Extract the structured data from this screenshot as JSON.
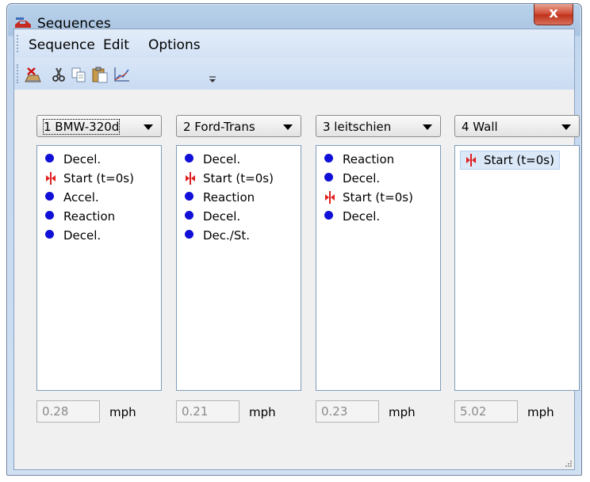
{
  "window": {
    "title": "Sequences",
    "close_label": "x"
  },
  "menu": [
    "Sequence",
    "Edit",
    "Options"
  ],
  "toolbar_icons": [
    "delete-icon",
    "cut-icon",
    "copy-icon",
    "paste-icon",
    "chart-icon",
    "toolbar-overflow-icon"
  ],
  "colors": {
    "dot": "#1010d8",
    "start_marker": "#e02020",
    "title_bar": "#b9d1ea",
    "close_button": "#c0331c"
  },
  "panels": [
    {
      "selector": "1 BMW-320d",
      "items": [
        {
          "type": "dot",
          "label": "Decel."
        },
        {
          "type": "start",
          "label": "Start (t=0s)"
        },
        {
          "type": "dot",
          "label": "Accel."
        },
        {
          "type": "dot",
          "label": "Reaction"
        },
        {
          "type": "dot",
          "label": "Decel."
        }
      ],
      "speed": "0.28",
      "unit": "mph"
    },
    {
      "selector": "2 Ford-Trans",
      "items": [
        {
          "type": "dot",
          "label": "Decel."
        },
        {
          "type": "start",
          "label": "Start (t=0s)"
        },
        {
          "type": "dot",
          "label": "Reaction"
        },
        {
          "type": "dot",
          "label": "Decel."
        },
        {
          "type": "dot",
          "label": "Dec./St."
        }
      ],
      "speed": "0.21",
      "unit": "mph"
    },
    {
      "selector": "3 leitschien",
      "items": [
        {
          "type": "dot",
          "label": "Reaction"
        },
        {
          "type": "dot",
          "label": "Decel."
        },
        {
          "type": "start",
          "label": "Start (t=0s)"
        },
        {
          "type": "dot",
          "label": "Decel."
        }
      ],
      "speed": "0.23",
      "unit": "mph"
    },
    {
      "selector": "4 Wall",
      "items": [
        {
          "type": "start",
          "label": "Start (t=0s)"
        }
      ],
      "speed": "5.02",
      "unit": "mph"
    }
  ]
}
